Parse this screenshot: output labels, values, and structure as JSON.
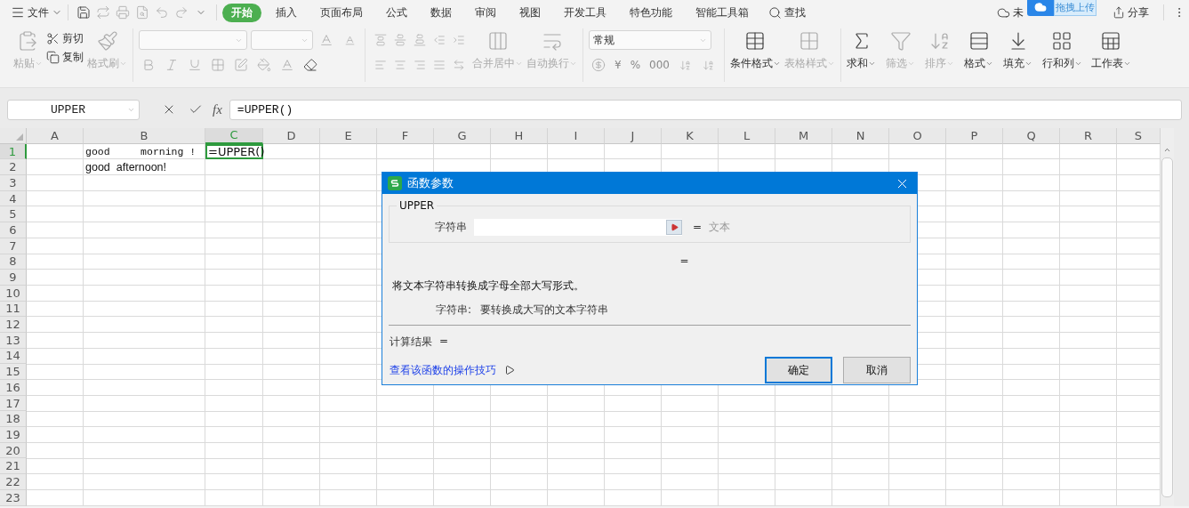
{
  "menu_bar": {
    "file_label": "文件",
    "tabs": [
      {
        "label": "开始",
        "selected": true
      },
      {
        "label": "插入",
        "selected": false
      },
      {
        "label": "页面布局",
        "selected": false
      },
      {
        "label": "公式",
        "selected": false
      },
      {
        "label": "数据",
        "selected": false
      },
      {
        "label": "审阅",
        "selected": false
      },
      {
        "label": "视图",
        "selected": false
      },
      {
        "label": "开发工具",
        "selected": false
      },
      {
        "label": "特色功能",
        "selected": false
      },
      {
        "label": "智能工具箱",
        "selected": false
      }
    ],
    "search_label": "查找",
    "sync_label": "未",
    "share_label": "分享",
    "upload_label": "拖拽上传"
  },
  "ribbon": {
    "clipboard": [
      {
        "kind": "large",
        "label": "粘贴",
        "disabled": true
      },
      {
        "kind": "small",
        "label": "剪切",
        "disabled": false
      },
      {
        "kind": "small",
        "label": "复制",
        "disabled": false
      },
      {
        "kind": "large",
        "label": "格式刷",
        "disabled": true
      }
    ],
    "alignment": [
      {
        "label": "合并居中",
        "disabled": true
      },
      {
        "label": "自动换行",
        "disabled": true
      }
    ],
    "number_format": "常规",
    "number_symbols": [
      "¥",
      "%",
      "000"
    ],
    "styles": [
      {
        "label": "条件格式",
        "disabled": false
      },
      {
        "label": "表格样式",
        "disabled": true
      }
    ],
    "editing": [
      {
        "label": "求和",
        "disabled": false
      },
      {
        "label": "筛选",
        "disabled": true
      },
      {
        "label": "排序",
        "disabled": true
      },
      {
        "label": "格式",
        "disabled": false
      },
      {
        "label": "填充",
        "disabled": false
      },
      {
        "label": "行和列",
        "disabled": false
      },
      {
        "label": "工作表",
        "disabled": false
      }
    ]
  },
  "formula_bar": {
    "name_box": "UPPER",
    "fx": "fx",
    "formula": "=UPPER()"
  },
  "sheet": {
    "columns": [
      {
        "label": "A",
        "selected": false
      },
      {
        "label": "B",
        "selected": false
      },
      {
        "label": "C",
        "selected": true
      },
      {
        "label": "D",
        "selected": false
      },
      {
        "label": "E",
        "selected": false
      },
      {
        "label": "F",
        "selected": false
      },
      {
        "label": "G",
        "selected": false
      },
      {
        "label": "H",
        "selected": false
      },
      {
        "label": "I",
        "selected": false
      },
      {
        "label": "J",
        "selected": false
      },
      {
        "label": "K",
        "selected": false
      },
      {
        "label": "L",
        "selected": false
      },
      {
        "label": "M",
        "selected": false
      },
      {
        "label": "N",
        "selected": false
      },
      {
        "label": "O",
        "selected": false
      },
      {
        "label": "P",
        "selected": false
      },
      {
        "label": "Q",
        "selected": false
      },
      {
        "label": "R",
        "selected": false
      },
      {
        "label": "S",
        "selected": false
      }
    ],
    "rows": [
      {
        "number": "1",
        "selected": true,
        "cells": [
          {
            "kind": "empty"
          },
          {
            "kind": "mono",
            "text": "good     morning !"
          },
          {
            "kind": "edit",
            "text": "=UPPER()"
          }
        ]
      },
      {
        "number": "2",
        "selected": false,
        "cells": [
          {
            "kind": "empty"
          },
          {
            "kind": "plain",
            "text": "good  afternoon!"
          }
        ]
      },
      {
        "number": "3",
        "selected": false
      },
      {
        "number": "4",
        "selected": false
      },
      {
        "number": "5",
        "selected": false
      },
      {
        "number": "6",
        "selected": false
      },
      {
        "number": "7",
        "selected": false
      },
      {
        "number": "8",
        "selected": false
      },
      {
        "number": "9",
        "selected": false
      },
      {
        "number": "10",
        "selected": false
      },
      {
        "number": "11",
        "selected": false
      },
      {
        "number": "12",
        "selected": false
      },
      {
        "number": "13",
        "selected": false
      },
      {
        "number": "14",
        "selected": false
      },
      {
        "number": "15",
        "selected": false
      },
      {
        "number": "16",
        "selected": false
      },
      {
        "number": "17",
        "selected": false
      },
      {
        "number": "18",
        "selected": false
      },
      {
        "number": "19",
        "selected": false
      },
      {
        "number": "20",
        "selected": false
      },
      {
        "number": "21",
        "selected": false
      },
      {
        "number": "22",
        "selected": false
      },
      {
        "number": "23",
        "selected": false
      }
    ]
  },
  "dialog": {
    "title": "函数参数",
    "function_name": "UPPER",
    "argument_label": "字符串",
    "argument_equals": "=",
    "argument_hint": "文本",
    "value_equals": "=",
    "description": "将文本字符串转换成字母全部大写形式。",
    "help_label": "字符串:",
    "help_text": "要转换成大写的文本字符串",
    "result_label": "计算结果",
    "result_equals": "=",
    "tips_link": "查看该函数的操作技巧",
    "buttons": [
      {
        "label": "确定",
        "default": true
      },
      {
        "label": "取消",
        "default": false
      }
    ]
  }
}
